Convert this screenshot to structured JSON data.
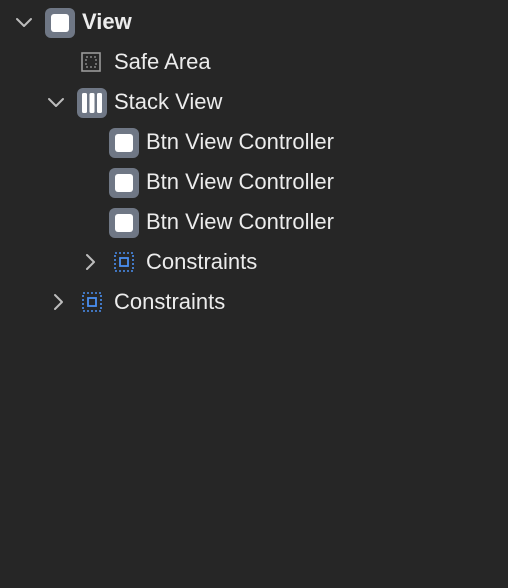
{
  "tree": {
    "root": {
      "label": "View",
      "icon": "view-icon",
      "expanded": true
    },
    "safe_area": {
      "label": "Safe Area",
      "icon": "safe-area-icon"
    },
    "stack_view": {
      "label": "Stack View",
      "icon": "stack-view-icon",
      "expanded": true
    },
    "buttons": [
      {
        "label": "Btn View Controller",
        "icon": "view-icon"
      },
      {
        "label": "Btn View Controller",
        "icon": "view-icon"
      },
      {
        "label": "Btn View Controller",
        "icon": "view-icon"
      }
    ],
    "stack_constraints": {
      "label": "Constraints",
      "icon": "constraints-icon",
      "expanded": false
    },
    "view_constraints": {
      "label": "Constraints",
      "icon": "constraints-icon",
      "expanded": false
    }
  },
  "colors": {
    "background": "#262626",
    "text": "#ececec",
    "icon_frame": "#6f7785",
    "icon_fill": "#ffffff",
    "constraint_blue": "#4a8ff0",
    "chevron": "#bdbdbd"
  }
}
